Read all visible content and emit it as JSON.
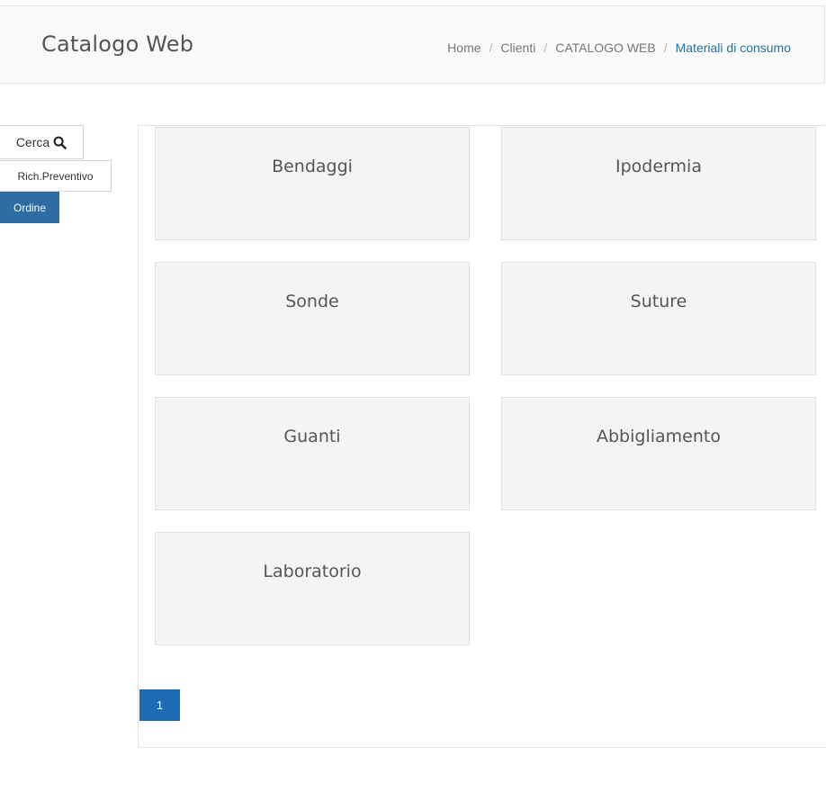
{
  "header": {
    "title": "Catalogo Web",
    "breadcrumb": [
      {
        "label": "Home"
      },
      {
        "label": "Clienti"
      },
      {
        "label": "CATALOGO WEB"
      },
      {
        "label": "Materiali di consumo"
      }
    ]
  },
  "actions": {
    "search_label": "Cerca",
    "quote_label": "Rich.Preventivo",
    "order_label": "Ordine"
  },
  "categories": [
    {
      "label": "Bendaggi"
    },
    {
      "label": "Ipodermia"
    },
    {
      "label": "Sonde"
    },
    {
      "label": "Suture"
    },
    {
      "label": "Guanti"
    },
    {
      "label": "Abbigliamento"
    },
    {
      "label": "Laboratorio"
    }
  ],
  "pagination": {
    "current_page": "1"
  },
  "colors": {
    "accent": "#2e6da4",
    "pager": "#1e6cb5",
    "breadcrumb_active": "#21749e",
    "card_bg": "#f4f4f4"
  }
}
